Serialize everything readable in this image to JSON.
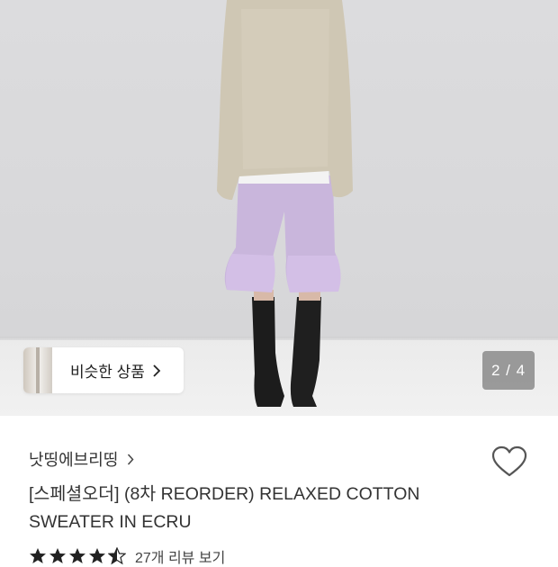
{
  "gallery": {
    "similar_label": "비슷한 상품",
    "page_indicator": "2 / 4",
    "icons": [
      "chevron-right-icon"
    ]
  },
  "product": {
    "brand": "낫띵에브리띵",
    "title_line1": "[스페셜오더] (8차 REORDER) RELAXED COTTON",
    "title_line2": "SWEATER IN ECRU",
    "rating": 4.5,
    "review_text": "27개 리뷰 보기"
  },
  "colors": {
    "background": "#ffffff",
    "text": "#333333",
    "star": "#222222",
    "heart_outline": "#555555"
  },
  "icons": [
    "heart-icon",
    "star-icon",
    "chevron-right-icon"
  ]
}
